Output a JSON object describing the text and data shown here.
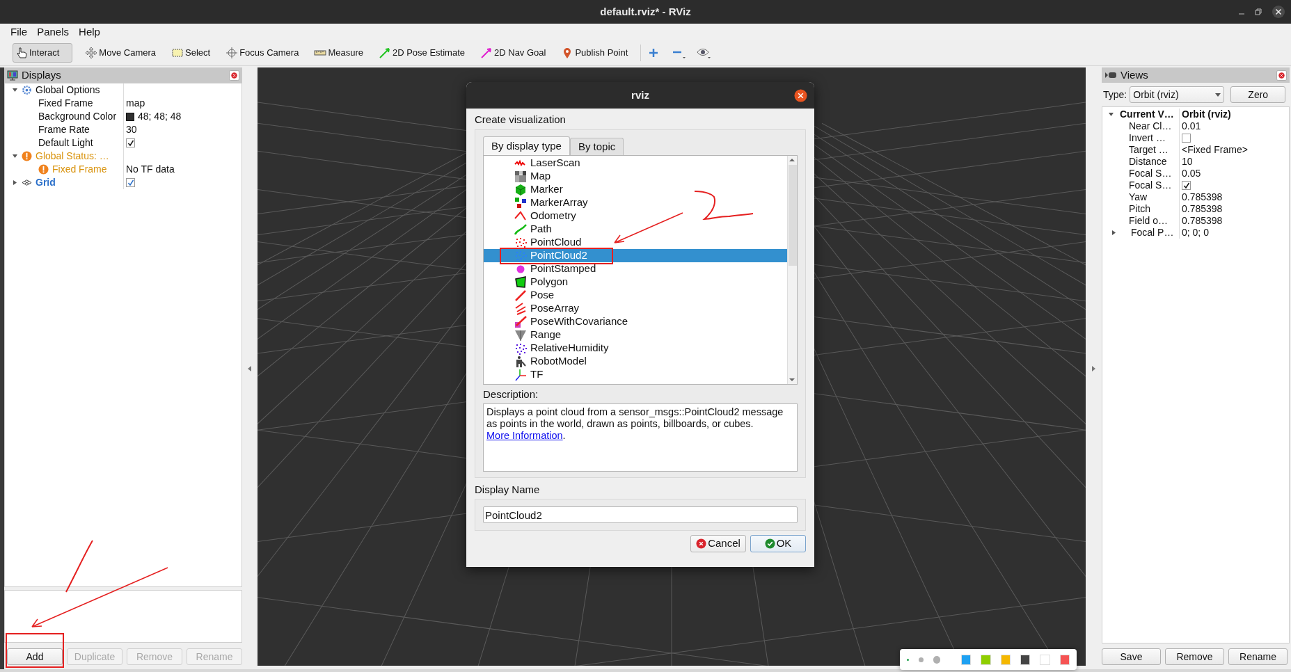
{
  "window": {
    "title": "default.rviz* - RViz"
  },
  "menu": [
    "File",
    "Panels",
    "Help"
  ],
  "toolbar": {
    "tools": [
      {
        "label": "Interact",
        "selected": true
      },
      {
        "label": "Move Camera",
        "selected": false
      },
      {
        "label": "Select",
        "selected": false
      },
      {
        "label": "Focus Camera",
        "selected": false
      },
      {
        "label": "Measure",
        "selected": false
      },
      {
        "label": "2D Pose Estimate",
        "selected": false
      },
      {
        "label": "2D Nav Goal",
        "selected": false
      },
      {
        "label": "Publish Point",
        "selected": false
      }
    ]
  },
  "displays": {
    "title": "Displays",
    "tree": [
      {
        "label": "Global Options",
        "kind": "group",
        "expanded": true,
        "children": [
          {
            "label": "Fixed Frame",
            "kind": "value",
            "value": "map"
          },
          {
            "label": "Background Color",
            "kind": "color",
            "value": "48; 48; 48",
            "color": "#303030"
          },
          {
            "label": "Frame Rate",
            "kind": "value",
            "value": "30"
          },
          {
            "label": "Default Light",
            "kind": "check",
            "checked": true
          }
        ]
      },
      {
        "label": "Global Status: …",
        "kind": "warning",
        "expanded": true,
        "children": [
          {
            "label": "Fixed Frame",
            "kind": "warning",
            "value": "No TF data"
          }
        ]
      },
      {
        "label": "Grid",
        "kind": "display",
        "expanded": false,
        "checked": true
      }
    ],
    "buttons": [
      {
        "label": "Add",
        "disabled": false
      },
      {
        "label": "Duplicate",
        "disabled": true
      },
      {
        "label": "Remove",
        "disabled": true
      },
      {
        "label": "Rename",
        "disabled": true
      }
    ]
  },
  "views": {
    "title": "Views",
    "type_label": "Type:",
    "type_value": "Orbit (rviz)",
    "zero_button": "Zero",
    "tree": {
      "label": "Current V…",
      "value": "Orbit (rviz)",
      "expanded": true,
      "children": [
        {
          "label": "Near Cl…",
          "kind": "value",
          "value": "0.01"
        },
        {
          "label": "Invert …",
          "kind": "check",
          "checked": false
        },
        {
          "label": "Target …",
          "kind": "value",
          "value": "<Fixed Frame>"
        },
        {
          "label": "Distance",
          "kind": "value",
          "value": "10"
        },
        {
          "label": "Focal S…",
          "kind": "value",
          "value": "0.05"
        },
        {
          "label": "Focal S…",
          "kind": "check",
          "checked": true
        },
        {
          "label": "Yaw",
          "kind": "value",
          "value": "0.785398"
        },
        {
          "label": "Pitch",
          "kind": "value",
          "value": "0.785398"
        },
        {
          "label": "Field o…",
          "kind": "value",
          "value": "0.785398"
        },
        {
          "label": "Focal P…",
          "kind": "expandable",
          "expanded": false,
          "value": "0; 0; 0"
        }
      ]
    },
    "buttons": [
      "Save",
      "Remove",
      "Rename"
    ]
  },
  "dialog": {
    "title": "rviz",
    "heading": "Create visualization",
    "tabs": [
      {
        "label": "By display type",
        "selected": true
      },
      {
        "label": "By topic",
        "selected": false
      }
    ],
    "items": [
      {
        "label": "LaserScan",
        "selected": false
      },
      {
        "label": "Map",
        "selected": false
      },
      {
        "label": "Marker",
        "selected": false
      },
      {
        "label": "MarkerArray",
        "selected": false
      },
      {
        "label": "Odometry",
        "selected": false
      },
      {
        "label": "Path",
        "selected": false
      },
      {
        "label": "PointCloud",
        "selected": false
      },
      {
        "label": "PointCloud2",
        "selected": true
      },
      {
        "label": "PointStamped",
        "selected": false
      },
      {
        "label": "Polygon",
        "selected": false
      },
      {
        "label": "Pose",
        "selected": false
      },
      {
        "label": "PoseArray",
        "selected": false
      },
      {
        "label": "PoseWithCovariance",
        "selected": false
      },
      {
        "label": "Range",
        "selected": false
      },
      {
        "label": "RelativeHumidity",
        "selected": false
      },
      {
        "label": "RobotModel",
        "selected": false
      },
      {
        "label": "TF",
        "selected": false
      }
    ],
    "description_label": "Description:",
    "description": "Displays a point cloud from a sensor_msgs::PointCloud2 message as points in the world, drawn as points, billboards, or cubes.",
    "description_link": "More Information",
    "description_end": ".",
    "name_label": "Display Name",
    "name_value": "PointCloud2",
    "buttons": [
      {
        "label": "Cancel",
        "kind": "cancel"
      },
      {
        "label": "OK",
        "kind": "ok"
      }
    ]
  },
  "palette": {
    "sizes": [
      {
        "selected": true
      },
      {
        "selected": false
      },
      {
        "selected": false
      }
    ],
    "colors": [
      {
        "color": "#1ea1f2"
      },
      {
        "color": "#8fce00"
      },
      {
        "color": "#f5b800"
      },
      {
        "color": "#444444"
      },
      {
        "color": "#ffffff"
      },
      {
        "color": "#f55353"
      }
    ]
  }
}
